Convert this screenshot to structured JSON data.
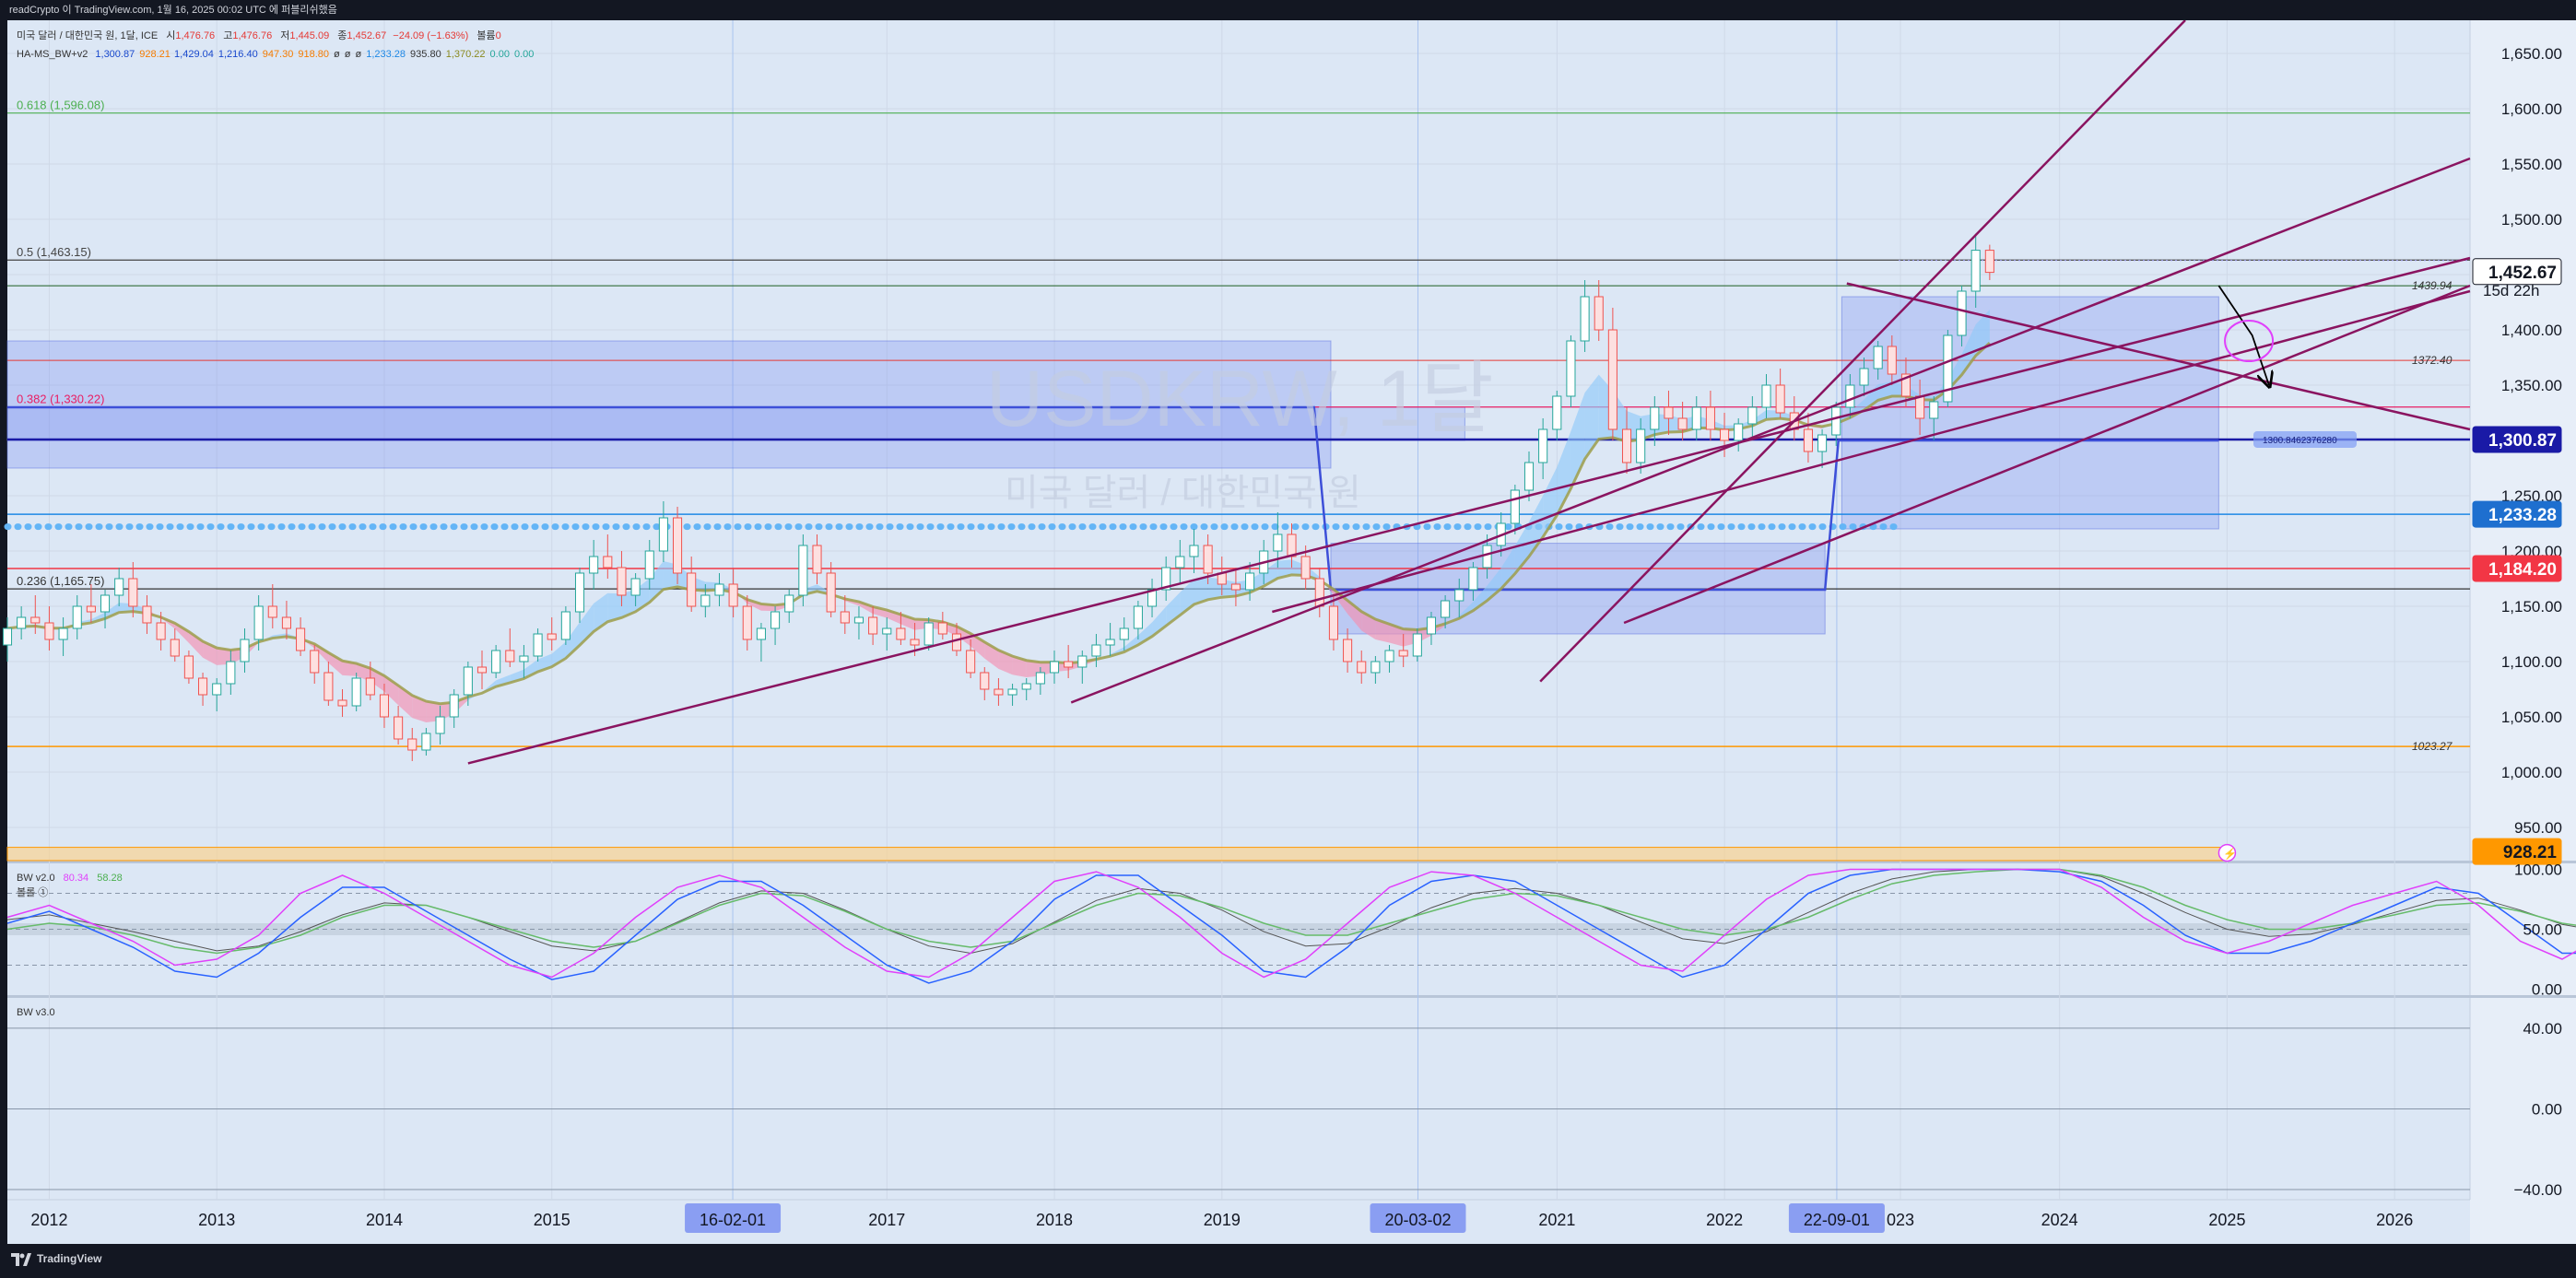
{
  "top_bar": {
    "text": "readCrypto 이 TradingView.com, 1월 16, 2025 00:02 UTC 에 퍼블리쉬했음"
  },
  "legend": {
    "symbol_line": {
      "name": "미국 달러 / 대한민국 원, 1달, ICE",
      "o_label": "시",
      "o_value": "1,476.76",
      "h_label": "고",
      "h_value": "1,476.76",
      "l_label": "저",
      "l_value": "1,445.09",
      "c_label": "종",
      "c_value": "1,452.67",
      "change": "−24.09 (−1.63%)",
      "vol_label": "볼륨",
      "vol_value": "0"
    },
    "indicator_line": {
      "name": "HA-MS_BW+v2",
      "values": [
        {
          "text": "1,300.87",
          "color": "#1848cc"
        },
        {
          "text": "928.21",
          "color": "#f57c00"
        },
        {
          "text": "1,429.04",
          "color": "#1848cc"
        },
        {
          "text": "1,216.40",
          "color": "#1848cc"
        },
        {
          "text": "947.30",
          "color": "#f57c00"
        },
        {
          "text": "918.80",
          "color": "#f57c00"
        },
        {
          "text": "ø",
          "color": "#333333"
        },
        {
          "text": "ø",
          "color": "#333333"
        },
        {
          "text": "ø",
          "color": "#333333"
        },
        {
          "text": "1,233.28",
          "color": "#1e88e5"
        },
        {
          "text": "935.80",
          "color": "#333333"
        },
        {
          "text": "1,370.22",
          "color": "#8a8a20"
        },
        {
          "text": "0.00",
          "color": "#26a69a"
        },
        {
          "text": "0.00",
          "color": "#26a69a"
        }
      ]
    }
  },
  "watermark": {
    "title": "USDKRW, 1달",
    "subtitle": "미국 달러 / 대한민국 원"
  },
  "fib_levels": [
    {
      "label": "0.618 (1,596.08)",
      "value": 1596.08,
      "color": "#4caf50"
    },
    {
      "label": "0.5 (1,463.15)",
      "value": 1463.15,
      "color": "#444444"
    },
    {
      "label": "0.382 (1,330.22)",
      "value": 1330.22,
      "color": "#e91e63"
    },
    {
      "label": "0.236 (1,165.75)",
      "value": 1165.75,
      "color": "#333333"
    }
  ],
  "line_labels": [
    {
      "text": "1439.94",
      "value": 1439.94
    },
    {
      "text": "1372.40",
      "value": 1372.4
    },
    {
      "text": "1023.27",
      "value": 1023.27
    }
  ],
  "small_tag": {
    "text": "1300.8462376280",
    "value": 1300.87
  },
  "countdown": "15d 22h",
  "price_axis": {
    "ticks": [
      "1,650.00",
      "1,600.00",
      "1,550.00",
      "1,500.00",
      "1,450.00",
      "1,400.00",
      "1,350.00",
      "1,300.00",
      "1,250.00",
      "1,200.00",
      "1,150.00",
      "1,100.00",
      "1,050.00",
      "1,000.00",
      "950.00"
    ],
    "tick_values": [
      1650,
      1600,
      1550,
      1500,
      1450,
      1400,
      1350,
      1300,
      1250,
      1200,
      1150,
      1100,
      1050,
      1000,
      950
    ],
    "badges": [
      {
        "text": "1,452.67",
        "value": 1452.67,
        "bg": "#ffffff",
        "fg": "#131722",
        "border": "#131722"
      },
      {
        "text": "1,300.87",
        "value": 1300.87,
        "bg": "#1a1aa6",
        "fg": "#ffffff",
        "border": "#1a1aa6"
      },
      {
        "text": "1,233.28",
        "value": 1233.28,
        "bg": "#1e6fcf",
        "fg": "#ffffff",
        "border": "#1e6fcf"
      },
      {
        "text": "1,184.20",
        "value": 1184.2,
        "bg": "#f23645",
        "fg": "#ffffff",
        "border": "#f23645"
      },
      {
        "text": "928.21",
        "value": 928.21,
        "bg": "#ff9800",
        "fg": "#131722",
        "border": "#ff9800"
      }
    ]
  },
  "pane2": {
    "name": "BW v2.0",
    "v1": {
      "text": "80.34",
      "color": "#e040fb"
    },
    "v2": {
      "text": "58.28",
      "color": "#4caf50"
    },
    "sub": "볼롤 ①",
    "ticks": [
      "100.00",
      "50.00",
      "0.00"
    ],
    "tick_values": [
      100,
      50,
      0
    ]
  },
  "pane3": {
    "name": "BW v3.0",
    "ticks": [
      "40.00",
      "0.00",
      "−40.00"
    ],
    "tick_values": [
      40,
      0,
      -40
    ]
  },
  "time_axis": {
    "years": [
      "2012",
      "2013",
      "2014",
      "2015",
      "2017",
      "2018",
      "2019",
      "2021",
      "2022",
      "023",
      "2024",
      "2025",
      "2026"
    ],
    "year_values": [
      2012.0,
      2013.0,
      2014.0,
      2015.0,
      2017.0,
      2018.0,
      2019.0,
      2021.0,
      2022.0,
      2023.05,
      2024.0,
      2025.0,
      2026.0
    ],
    "highlights": [
      {
        "text": "16-02-01",
        "value": 2016.08
      },
      {
        "text": "20-03-02",
        "value": 2020.17
      },
      {
        "text": "22-09-01",
        "value": 2022.67
      }
    ]
  },
  "bottom_bar": {
    "logo_text": "TradingView"
  },
  "chart_data": {
    "type": "candlestick",
    "title": "USDKRW, 1달",
    "subtitle": "미국 달러 / 대한민국 원",
    "x_range": [
      2011.75,
      2026.45
    ],
    "y_range": [
      920,
      1680
    ],
    "candle_start": 2011.75,
    "candle_step_years": 0.08333,
    "candles_ohlc": [
      [
        1115,
        1140,
        1100,
        1130
      ],
      [
        1130,
        1150,
        1120,
        1140
      ],
      [
        1140,
        1160,
        1125,
        1135
      ],
      [
        1135,
        1150,
        1110,
        1120
      ],
      [
        1120,
        1140,
        1105,
        1130
      ],
      [
        1130,
        1160,
        1120,
        1150
      ],
      [
        1150,
        1170,
        1135,
        1145
      ],
      [
        1145,
        1165,
        1130,
        1160
      ],
      [
        1160,
        1185,
        1150,
        1175
      ],
      [
        1175,
        1190,
        1140,
        1150
      ],
      [
        1150,
        1160,
        1125,
        1135
      ],
      [
        1135,
        1145,
        1110,
        1120
      ],
      [
        1120,
        1130,
        1100,
        1105
      ],
      [
        1105,
        1110,
        1080,
        1085
      ],
      [
        1085,
        1090,
        1060,
        1070
      ],
      [
        1070,
        1085,
        1055,
        1080
      ],
      [
        1080,
        1110,
        1070,
        1100
      ],
      [
        1100,
        1130,
        1090,
        1120
      ],
      [
        1120,
        1160,
        1110,
        1150
      ],
      [
        1150,
        1170,
        1130,
        1140
      ],
      [
        1140,
        1155,
        1120,
        1130
      ],
      [
        1130,
        1140,
        1105,
        1110
      ],
      [
        1110,
        1115,
        1080,
        1090
      ],
      [
        1090,
        1100,
        1060,
        1065
      ],
      [
        1065,
        1075,
        1050,
        1060
      ],
      [
        1060,
        1090,
        1055,
        1085
      ],
      [
        1085,
        1100,
        1065,
        1070
      ],
      [
        1070,
        1080,
        1040,
        1050
      ],
      [
        1050,
        1060,
        1025,
        1030
      ],
      [
        1030,
        1040,
        1010,
        1020
      ],
      [
        1020,
        1040,
        1015,
        1035
      ],
      [
        1035,
        1060,
        1025,
        1050
      ],
      [
        1050,
        1075,
        1040,
        1070
      ],
      [
        1070,
        1100,
        1060,
        1095
      ],
      [
        1095,
        1110,
        1075,
        1090
      ],
      [
        1090,
        1115,
        1085,
        1110
      ],
      [
        1110,
        1130,
        1095,
        1100
      ],
      [
        1100,
        1115,
        1085,
        1105
      ],
      [
        1105,
        1130,
        1100,
        1125
      ],
      [
        1125,
        1140,
        1110,
        1120
      ],
      [
        1120,
        1150,
        1115,
        1145
      ],
      [
        1145,
        1185,
        1135,
        1180
      ],
      [
        1180,
        1210,
        1165,
        1195
      ],
      [
        1195,
        1215,
        1175,
        1185
      ],
      [
        1185,
        1200,
        1150,
        1160
      ],
      [
        1160,
        1180,
        1150,
        1175
      ],
      [
        1175,
        1210,
        1165,
        1200
      ],
      [
        1200,
        1245,
        1190,
        1230
      ],
      [
        1230,
        1240,
        1170,
        1180
      ],
      [
        1180,
        1195,
        1145,
        1150
      ],
      [
        1150,
        1170,
        1140,
        1160
      ],
      [
        1160,
        1180,
        1150,
        1170
      ],
      [
        1170,
        1185,
        1140,
        1150
      ],
      [
        1150,
        1160,
        1110,
        1120
      ],
      [
        1120,
        1135,
        1100,
        1130
      ],
      [
        1130,
        1150,
        1115,
        1145
      ],
      [
        1145,
        1165,
        1135,
        1160
      ],
      [
        1160,
        1215,
        1150,
        1205
      ],
      [
        1205,
        1215,
        1170,
        1180
      ],
      [
        1180,
        1190,
        1140,
        1145
      ],
      [
        1145,
        1160,
        1125,
        1135
      ],
      [
        1135,
        1150,
        1120,
        1140
      ],
      [
        1140,
        1150,
        1115,
        1125
      ],
      [
        1125,
        1140,
        1110,
        1130
      ],
      [
        1130,
        1145,
        1115,
        1120
      ],
      [
        1120,
        1135,
        1105,
        1115
      ],
      [
        1115,
        1140,
        1110,
        1135
      ],
      [
        1135,
        1145,
        1120,
        1125
      ],
      [
        1125,
        1135,
        1105,
        1110
      ],
      [
        1110,
        1120,
        1085,
        1090
      ],
      [
        1090,
        1095,
        1065,
        1075
      ],
      [
        1075,
        1085,
        1060,
        1070
      ],
      [
        1070,
        1080,
        1060,
        1075
      ],
      [
        1075,
        1085,
        1065,
        1080
      ],
      [
        1080,
        1095,
        1070,
        1090
      ],
      [
        1090,
        1110,
        1080,
        1100
      ],
      [
        1100,
        1115,
        1085,
        1095
      ],
      [
        1095,
        1110,
        1080,
        1105
      ],
      [
        1105,
        1125,
        1095,
        1115
      ],
      [
        1115,
        1135,
        1105,
        1120
      ],
      [
        1120,
        1140,
        1110,
        1130
      ],
      [
        1130,
        1155,
        1120,
        1150
      ],
      [
        1150,
        1175,
        1140,
        1165
      ],
      [
        1165,
        1195,
        1155,
        1185
      ],
      [
        1185,
        1210,
        1170,
        1195
      ],
      [
        1195,
        1220,
        1180,
        1205
      ],
      [
        1205,
        1215,
        1170,
        1180
      ],
      [
        1180,
        1195,
        1160,
        1170
      ],
      [
        1170,
        1185,
        1150,
        1165
      ],
      [
        1165,
        1190,
        1155,
        1180
      ],
      [
        1180,
        1210,
        1170,
        1200
      ],
      [
        1200,
        1235,
        1185,
        1215
      ],
      [
        1215,
        1225,
        1185,
        1195
      ],
      [
        1195,
        1205,
        1165,
        1175
      ],
      [
        1175,
        1185,
        1140,
        1150
      ],
      [
        1150,
        1160,
        1110,
        1120
      ],
      [
        1120,
        1130,
        1090,
        1100
      ],
      [
        1100,
        1110,
        1080,
        1090
      ],
      [
        1090,
        1105,
        1080,
        1100
      ],
      [
        1100,
        1115,
        1090,
        1110
      ],
      [
        1110,
        1125,
        1095,
        1105
      ],
      [
        1105,
        1130,
        1100,
        1125
      ],
      [
        1125,
        1145,
        1115,
        1140
      ],
      [
        1140,
        1160,
        1130,
        1155
      ],
      [
        1155,
        1175,
        1140,
        1165
      ],
      [
        1165,
        1190,
        1155,
        1185
      ],
      [
        1185,
        1215,
        1175,
        1205
      ],
      [
        1205,
        1235,
        1195,
        1225
      ],
      [
        1225,
        1260,
        1215,
        1255
      ],
      [
        1255,
        1290,
        1245,
        1280
      ],
      [
        1280,
        1320,
        1265,
        1310
      ],
      [
        1310,
        1345,
        1300,
        1340
      ],
      [
        1340,
        1395,
        1330,
        1390
      ],
      [
        1390,
        1445,
        1380,
        1430
      ],
      [
        1430,
        1445,
        1390,
        1400
      ],
      [
        1400,
        1420,
        1300,
        1310
      ],
      [
        1310,
        1330,
        1270,
        1280
      ],
      [
        1280,
        1320,
        1270,
        1310
      ],
      [
        1310,
        1340,
        1295,
        1330
      ],
      [
        1330,
        1345,
        1305,
        1320
      ],
      [
        1320,
        1335,
        1300,
        1310
      ],
      [
        1310,
        1340,
        1300,
        1330
      ],
      [
        1330,
        1345,
        1300,
        1310
      ],
      [
        1310,
        1325,
        1285,
        1300
      ],
      [
        1300,
        1320,
        1290,
        1315
      ],
      [
        1315,
        1340,
        1300,
        1330
      ],
      [
        1330,
        1360,
        1320,
        1350
      ],
      [
        1350,
        1365,
        1320,
        1325
      ],
      [
        1325,
        1340,
        1300,
        1310
      ],
      [
        1310,
        1325,
        1280,
        1290
      ],
      [
        1290,
        1310,
        1275,
        1305
      ],
      [
        1305,
        1335,
        1295,
        1330
      ],
      [
        1330,
        1360,
        1320,
        1350
      ],
      [
        1350,
        1375,
        1340,
        1365
      ],
      [
        1365,
        1390,
        1355,
        1385
      ],
      [
        1385,
        1395,
        1350,
        1360
      ],
      [
        1360,
        1375,
        1330,
        1340
      ],
      [
        1340,
        1355,
        1305,
        1320
      ],
      [
        1320,
        1340,
        1300,
        1335
      ],
      [
        1335,
        1400,
        1330,
        1395
      ],
      [
        1395,
        1440,
        1385,
        1435
      ],
      [
        1435,
        1487,
        1420,
        1472
      ],
      [
        1472,
        1477,
        1445,
        1452
      ]
    ],
    "fib_levels": [
      {
        "ratio": 0.618,
        "value": 1596.08
      },
      {
        "ratio": 0.5,
        "value": 1463.15
      },
      {
        "ratio": 0.382,
        "value": 1330.22
      },
      {
        "ratio": 0.236,
        "value": 1165.75
      }
    ],
    "horizontal_levels": [
      1439.94,
      1372.4,
      1300.87,
      1233.28,
      1184.2,
      1023.27,
      928.21
    ],
    "last_close": 1452.67,
    "bw_v2": {
      "y_range": [
        -5,
        105
      ],
      "guides": [
        80,
        50,
        20
      ],
      "series_x_start": 2011.75,
      "series_x_step": 0.25,
      "pink": [
        60,
        70,
        55,
        40,
        20,
        25,
        45,
        80,
        95,
        80,
        60,
        40,
        20,
        10,
        30,
        60,
        85,
        95,
        85,
        60,
        35,
        15,
        10,
        30,
        60,
        90,
        98,
        85,
        60,
        30,
        10,
        25,
        55,
        85,
        98,
        95,
        80,
        60,
        40,
        20,
        15,
        45,
        75,
        95,
        100,
        100,
        100,
        100,
        100,
        100,
        85,
        60,
        40,
        30,
        40,
        55,
        70,
        80,
        90,
        70,
        40,
        25,
        45,
        80
      ],
      "blue": [
        55,
        65,
        50,
        35,
        15,
        10,
        30,
        60,
        85,
        85,
        65,
        45,
        25,
        8,
        15,
        45,
        75,
        90,
        90,
        70,
        45,
        20,
        5,
        15,
        40,
        75,
        95,
        95,
        70,
        45,
        15,
        10,
        35,
        70,
        90,
        95,
        90,
        70,
        50,
        30,
        10,
        20,
        50,
        80,
        95,
        100,
        100,
        100,
        100,
        98,
        90,
        70,
        45,
        30,
        30,
        40,
        55,
        70,
        85,
        80,
        55,
        30,
        30,
        60
      ],
      "green": [
        50,
        55,
        52,
        45,
        35,
        30,
        35,
        45,
        60,
        70,
        70,
        60,
        50,
        40,
        35,
        40,
        55,
        70,
        80,
        78,
        65,
        50,
        40,
        35,
        40,
        55,
        70,
        80,
        78,
        68,
        55,
        45,
        45,
        55,
        65,
        75,
        80,
        78,
        70,
        60,
        50,
        45,
        50,
        60,
        75,
        88,
        95,
        98,
        100,
        100,
        95,
        85,
        70,
        58,
        50,
        50,
        55,
        62,
        70,
        72,
        65,
        55,
        50,
        58
      ],
      "gray": [
        58,
        62,
        55,
        48,
        40,
        32,
        36,
        48,
        62,
        72,
        70,
        60,
        48,
        36,
        32,
        40,
        56,
        72,
        82,
        80,
        66,
        50,
        36,
        30,
        38,
        56,
        74,
        84,
        80,
        66,
        48,
        36,
        38,
        52,
        68,
        80,
        84,
        80,
        70,
        56,
        42,
        38,
        48,
        64,
        80,
        92,
        98,
        100,
        100,
        100,
        94,
        80,
        64,
        50,
        44,
        46,
        54,
        64,
        74,
        76,
        66,
        54,
        48,
        56
      ]
    },
    "bw_v3": {
      "y_range": [
        -45,
        55
      ],
      "guides": [
        40,
        0,
        -40
      ]
    }
  }
}
